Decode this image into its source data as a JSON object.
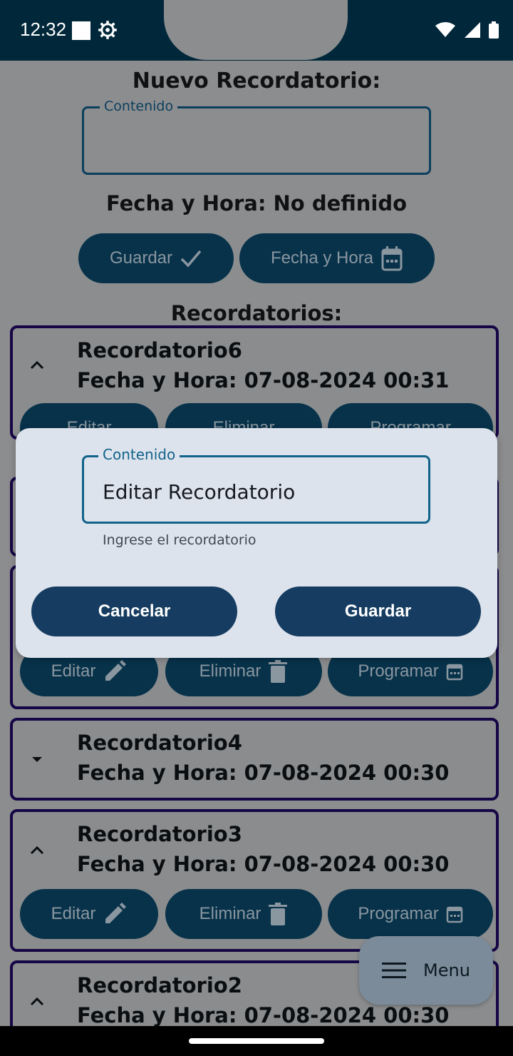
{
  "status_bar": {
    "time": "12:32"
  },
  "form": {
    "title": "Nuevo Recordatorio:",
    "content_label": "Contenido",
    "date_status": "Fecha y Hora: No definido",
    "save_label": "Guardar",
    "datetime_label": "Fecha y Hora"
  },
  "list": {
    "heading": "Recordatorios:",
    "items": [
      {
        "title": "Recordatorio6",
        "datetime": "Fecha y Hora: 07-08-2024 00:31",
        "expanded": true
      },
      {
        "title": "Recordatorio4",
        "datetime": "Fecha y Hora: 07-08-2024 00:30",
        "expanded": false
      },
      {
        "title": "Recordatorio3",
        "datetime": "Fecha y Hora: 07-08-2024 00:30",
        "expanded": true
      },
      {
        "title": "Recordatorio2",
        "datetime": "Fecha y Hora: 07-08-2024 00:30",
        "expanded": true
      }
    ],
    "actions": {
      "edit": "Editar",
      "delete": "Eliminar",
      "schedule": "Programar"
    }
  },
  "fab": {
    "label": "Menu"
  },
  "dialog": {
    "field_label": "Contenido",
    "field_value": "Editar Recordatorio",
    "helper": "Ingrese el recordatorio",
    "cancel_label": "Cancelar",
    "save_label": "Guardar"
  },
  "colors": {
    "status_bar": "#01283a",
    "scrim_background": "#8c8d8f",
    "button_dark": "#07324a",
    "dialog_surface": "#dde3ec",
    "dialog_button": "#163d61",
    "card_border": "#160645"
  }
}
